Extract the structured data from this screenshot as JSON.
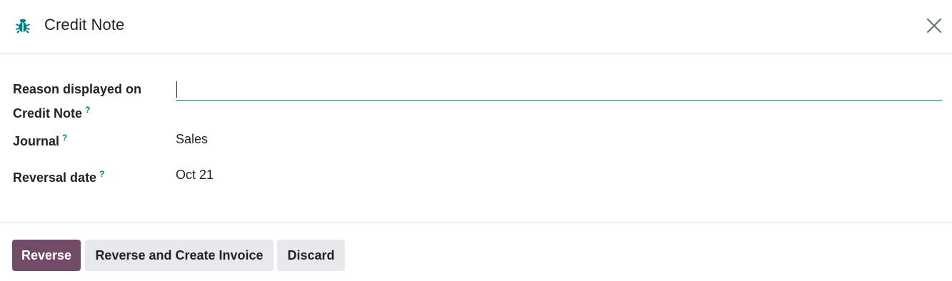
{
  "dialog": {
    "title": "Credit Note",
    "title_icon": "bug-icon",
    "close_icon": "close-icon"
  },
  "fields": {
    "reason": {
      "label": "Reason displayed on Credit Note",
      "help": "?",
      "value": "",
      "placeholder": ""
    },
    "journal": {
      "label": "Journal",
      "help": "?",
      "value": "Sales"
    },
    "reversal_date": {
      "label": "Reversal date",
      "help": "?",
      "value": "Oct 21"
    }
  },
  "footer": {
    "reverse_label": "Reverse",
    "reverse_create_invoice_label": "Reverse and Create Invoice",
    "discard_label": "Discard"
  },
  "colors": {
    "primary": "#714b67",
    "accent": "#017e84",
    "secondary_button": "#e7e9ed"
  }
}
